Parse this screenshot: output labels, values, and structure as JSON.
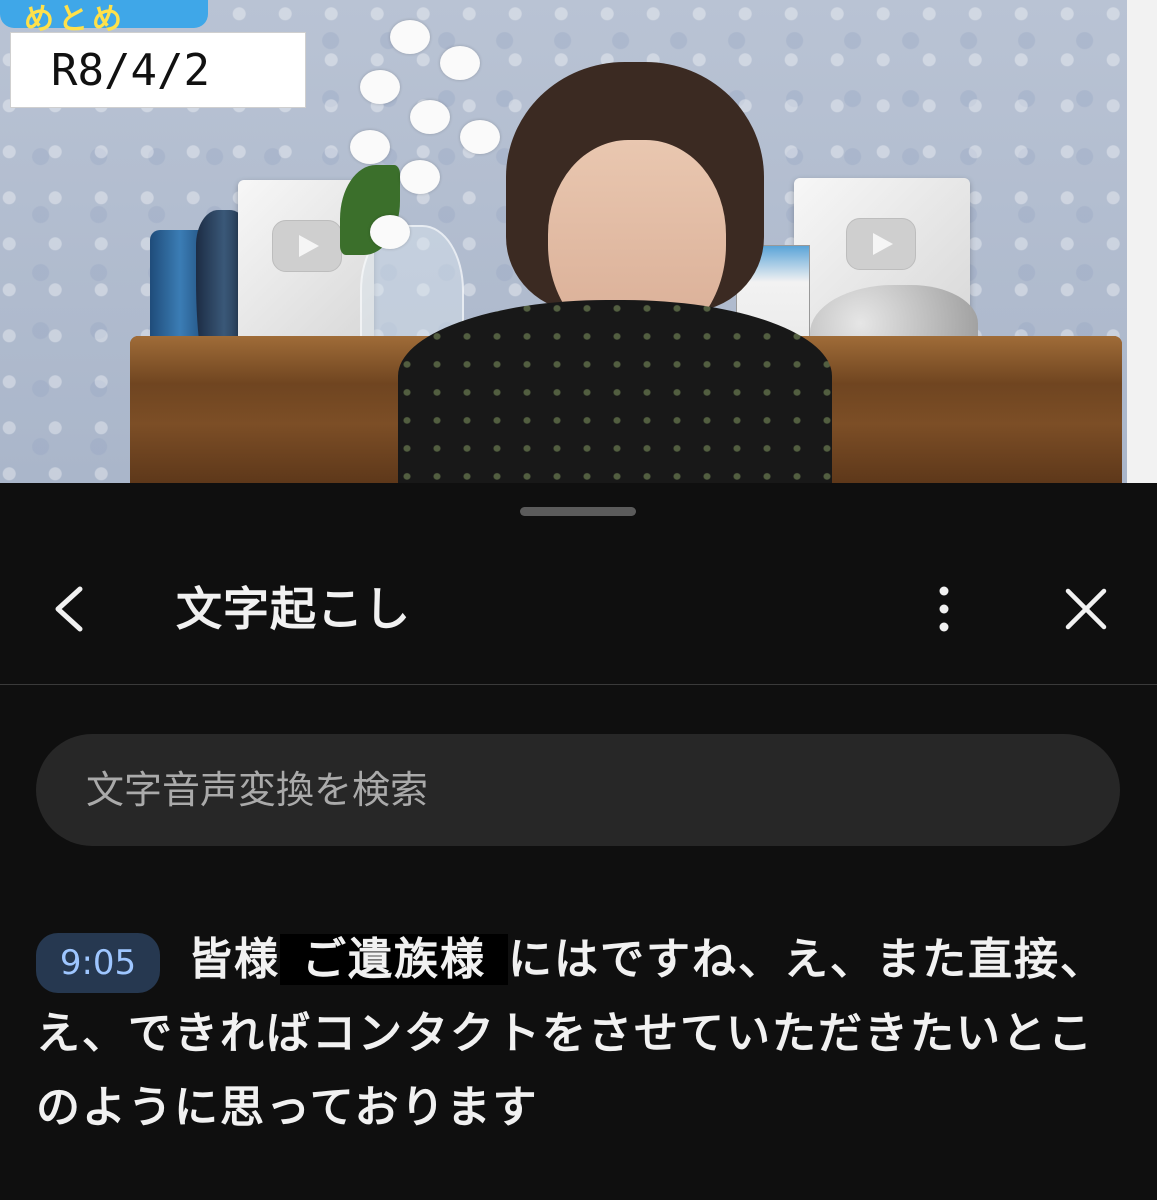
{
  "video": {
    "date_label": "R8/4/2"
  },
  "panel": {
    "title": "文字起こし",
    "search_placeholder": "文字音声変換を検索",
    "segment": {
      "timestamp": "9:05",
      "text_before": "皆様",
      "highlighted": "ご遺族様",
      "text_after": "にはですね、え、また直接、え、できればコンタクトをさせていただきたいとこのように思っております"
    }
  }
}
